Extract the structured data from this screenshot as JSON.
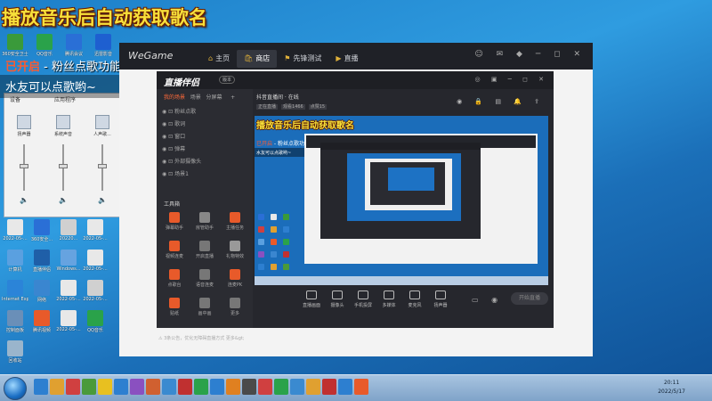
{
  "overlay": {
    "title": "播放音乐后自动获取歌名",
    "status_on": "已开启",
    "status_feature": " - 粉丝点歌功能",
    "viewer_caption": "水友可以点歌哟~"
  },
  "desktop": {
    "icons_top": [
      {
        "label": "360安全卫士",
        "color": "#3a9a3a"
      },
      {
        "label": "QQ音乐",
        "color": "#2aa24a"
      },
      {
        "label": "腾讯会议",
        "color": "#2a6fd6"
      },
      {
        "label": "迅雷影音",
        "color": "#1e5fd0"
      }
    ],
    "icons_bottom": [
      {
        "label": "2022-05-...",
        "color": "#e8e8e8"
      },
      {
        "label": "360安全...",
        "color": "#2a6fd6"
      },
      {
        "label": "20220...",
        "color": "#d0d0d0"
      },
      {
        "label": "2022-05-...",
        "color": "#e8e8e8"
      },
      {
        "label": "计算机",
        "color": "#5aa0e0"
      },
      {
        "label": "直播伴侣",
        "color": "#1f5fa8"
      },
      {
        "label": "Windows...",
        "color": "#66a3e0"
      },
      {
        "label": "2022-05-...",
        "color": "#e8e8e8"
      },
      {
        "label": "Internet Explorer",
        "color": "#2b84d8"
      },
      {
        "label": "网络",
        "color": "#3a86d0"
      },
      {
        "label": "2022-05-...",
        "color": "#e8e8e8"
      },
      {
        "label": "2022-05-...",
        "color": "#d0d0d0"
      },
      {
        "label": "控制面板",
        "color": "#6a8fb8"
      },
      {
        "label": "腾讯视频",
        "color": "#e85a2a"
      },
      {
        "label": "2022-05-...",
        "color": "#e8e8e8"
      },
      {
        "label": "QQ音乐",
        "color": "#2aa24a"
      },
      {
        "label": "回收站",
        "color": "#9ab5cc"
      }
    ]
  },
  "mixer": {
    "device_header": "设备",
    "apps_header": "应用程序",
    "columns": [
      {
        "label": "扬声器",
        "level": 0.55
      },
      {
        "label": "系统声音",
        "level": 0.55
      },
      {
        "label": "人声歌...",
        "level": 0.55
      }
    ]
  },
  "wegame": {
    "logo": "WeGame",
    "tabs": [
      {
        "label": "主页",
        "icon": "⌂",
        "active": false
      },
      {
        "label": "商店",
        "icon": "🛍",
        "active": true
      },
      {
        "label": "先锋测试",
        "icon": "⚑",
        "active": false
      },
      {
        "label": "直播",
        "icon": "▶",
        "active": false
      }
    ],
    "window_controls": "☺ ✉ ◆ ─ ◻ ✕"
  },
  "zhibo": {
    "logo": "直播伴侣",
    "version": "版本",
    "window_controls": "◎ ▣ ─ ◻ ✕",
    "left_tabs": {
      "active": "我的场景",
      "others": [
        "场景",
        "分屏幕"
      ]
    },
    "scenes": [
      "粉丝点歌",
      "歌词",
      "窗口",
      "弹幕",
      "外部摄像头",
      "场景1"
    ],
    "tools_header": "工具箱",
    "tools": [
      {
        "label": "弹幕助手",
        "color": "#e85a2a"
      },
      {
        "label": "房管助手",
        "color": "#888888"
      },
      {
        "label": "主播任务",
        "color": "#e85a2a"
      },
      {
        "label": "视频连麦",
        "color": "#e85a2a"
      },
      {
        "label": "开启直播",
        "color": "#777777"
      },
      {
        "label": "礼物特效",
        "color": "#999999"
      },
      {
        "label": "点歌台",
        "color": "#e85a2a"
      },
      {
        "label": "语音连麦",
        "color": "#777777"
      },
      {
        "label": "连麦PK",
        "color": "#e85a2a"
      },
      {
        "label": "贴纸",
        "color": "#e85a2a"
      },
      {
        "label": "画中画",
        "color": "#777777"
      },
      {
        "label": "更多",
        "color": "#777777"
      }
    ],
    "notice": "⚠ 3条公告，优化无障碍直播方式 更多&gt;",
    "room": "抖音直播间 · 在线",
    "room_stats": [
      "正在直播",
      "观看1466",
      "点赞15"
    ],
    "top_icons": "◉ 🔒 ▤ 🔔 ⇪",
    "controls": [
      {
        "label": "直播画面"
      },
      {
        "label": "摄像头"
      },
      {
        "label": "手机投屏"
      },
      {
        "label": "多媒体"
      },
      {
        "label": "麦克风"
      },
      {
        "label": "扬声器"
      }
    ],
    "small_icons": "▭ ◉ ⚙",
    "go_live": "开始直播"
  },
  "preview": {
    "title": "播放音乐后自动获取歌名",
    "status_on": "已开启",
    "status_feature": " - 粉丝点歌功能",
    "caption": "水友可以点歌哟~"
  },
  "taskbar": {
    "buttons": [
      "#2d7fd0",
      "#e0a030",
      "#d04040",
      "#4a9a3a",
      "#e8c020",
      "#2d7fd0",
      "#8a50c0",
      "#d06030",
      "#3a8ad0",
      "#c03030",
      "#2aa24a",
      "#2d7fd0",
      "#e08020",
      "#4a4a4a",
      "#d04040",
      "#2aa24a",
      "#3a8ad0",
      "#e0a030",
      "#c03030",
      "#2d7fd0",
      "#e85a2a"
    ],
    "time": "20:11",
    "date": "2022/5/17"
  }
}
